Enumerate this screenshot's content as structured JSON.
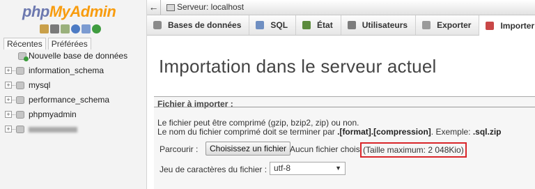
{
  "app": {
    "logo_part1": "php",
    "logo_part2": "MyAdmin"
  },
  "nav": {
    "tabs": [
      "Récentes",
      "Préférées"
    ],
    "new_db_label": "Nouvelle base de données",
    "databases": [
      "information_schema",
      "mysql",
      "performance_schema",
      "phpmyadmin"
    ],
    "nav_icons": [
      "home-icon",
      "exit-icon",
      "settings-icon",
      "help-icon",
      "docs-icon",
      "reload-icon"
    ]
  },
  "topbar": {
    "server_label": "Serveur: localhost"
  },
  "menu": {
    "tabs": [
      {
        "label": "Bases de données",
        "icon": "database-icon"
      },
      {
        "label": "SQL",
        "icon": "sql-icon"
      },
      {
        "label": "État",
        "icon": "status-icon"
      },
      {
        "label": "Utilisateurs",
        "icon": "users-icon"
      },
      {
        "label": "Exporter",
        "icon": "export-icon"
      },
      {
        "label": "Importer",
        "icon": "import-icon",
        "active": true
      }
    ]
  },
  "page": {
    "title": "Importation dans le serveur actuel",
    "section_title": "Fichier à importer :",
    "note_line1": "Le fichier peut être comprimé (gzip, bzip2, zip) ou non.",
    "note_line2_prefix": "Le nom du fichier comprimé doit se terminer par ",
    "note_line2_format": ".[format].[compression]",
    "note_line2_mid": ". Exemple: ",
    "note_line2_example": ".sql.zip",
    "browse_label": "Parcourir :",
    "file_button": "Choisissez un fichier",
    "no_file": "Aucun fichier choisi",
    "max_size": "(Taille maximum: 2 048Kio)",
    "charset_label": "Jeu de caractères du fichier :",
    "charset_value": "utf-8"
  },
  "colors": {
    "logo_php": "#6c78af",
    "logo_myadmin": "#f89c0e",
    "highlight_box": "#d9262a"
  }
}
